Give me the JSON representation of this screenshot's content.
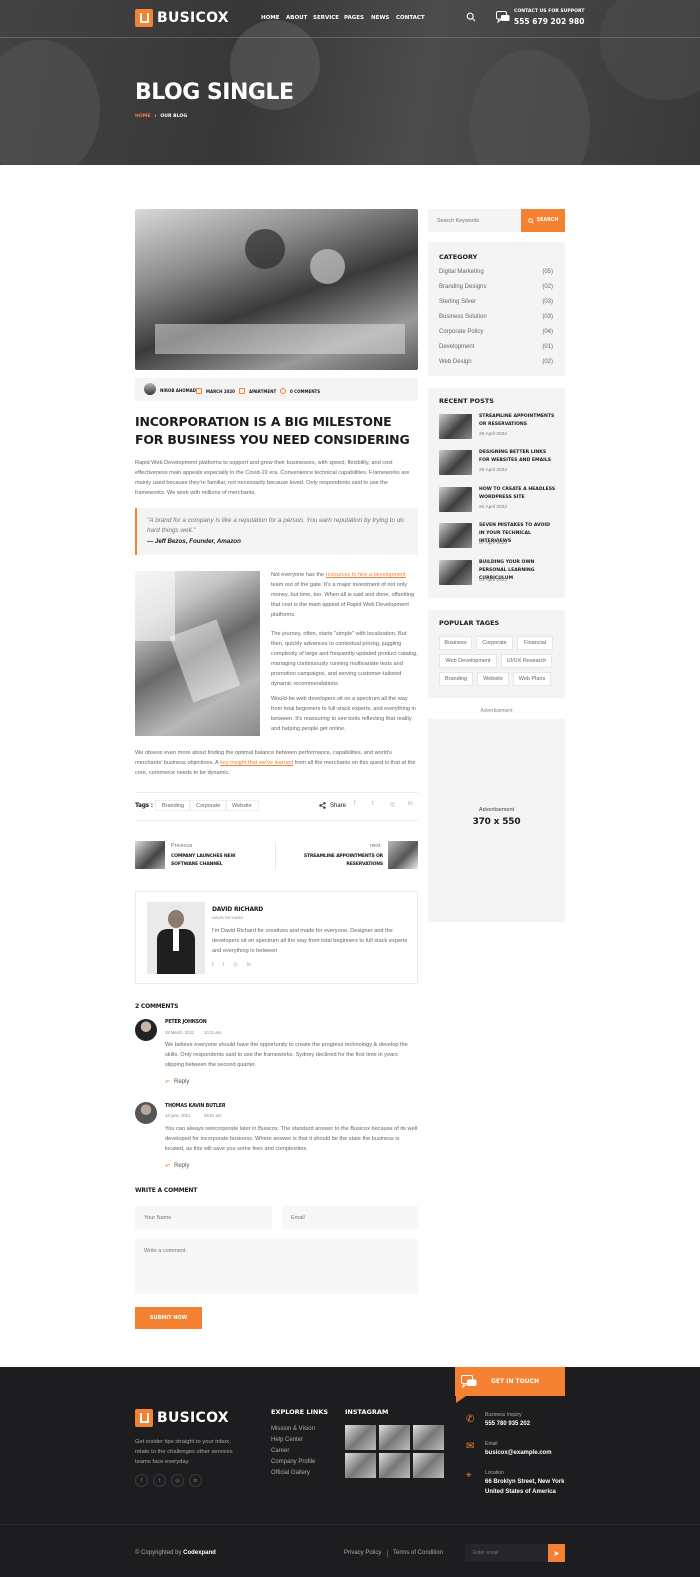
{
  "brand": {
    "name": "BUSICOX",
    "accent": "#f58133",
    "dark": "#1d1d1f"
  },
  "nav": {
    "items": [
      "HOME",
      "ABOUT",
      "SERVICE",
      "PAGES",
      "NEWS",
      "CONTACT"
    ],
    "support_label": "CONTACT US FOR SUPPORT",
    "support_phone": "555 679 202 980",
    "icons": {
      "search": "search-icon",
      "chat": "chat-icon"
    }
  },
  "hero": {
    "title": "BLOG SINGLE",
    "breadcrumb_home": "HOME",
    "breadcrumb_sep": "›",
    "breadcrumb_current": "OUR BLOG"
  },
  "sidebar": {
    "search_placeholder": "Search Keywords",
    "search_button": "SEARCH",
    "category_title": "CATEGORY",
    "categories": [
      {
        "name": "Digital Marketing",
        "count": "(05)"
      },
      {
        "name": "Branding Designs",
        "count": "(02)"
      },
      {
        "name": "Sterling Silver",
        "count": "(03)"
      },
      {
        "name": "Business Solution",
        "count": "(03)"
      },
      {
        "name": "Corporate Policy",
        "count": "(04)"
      },
      {
        "name": "Development",
        "count": "(01)"
      },
      {
        "name": "Web Design",
        "count": "(02)"
      }
    ],
    "recent_title": "RECENT POSTS",
    "recent": [
      {
        "title": "STREAMLINE APPOINTMENTS OR RESERVATIONS",
        "date": "28 April 2022"
      },
      {
        "title": "DESIGNING BETTER LINKS FOR WEBSITES AND EMAILS",
        "date": "25 April 2022"
      },
      {
        "title": "HOW TO CREATE A HEADLESS WORDPRESS SITE",
        "date": "20 April 2022"
      },
      {
        "title": "SEVEN MISTAKES TO AVOID IN YOUR TECHNICAL INTERVIEWS",
        "date": "07 April 2022"
      },
      {
        "title": "BUILDING YOUR OWN PERSONAL LEARNING CURRICULUM",
        "date": "03 April 2022"
      }
    ],
    "tags_title": "POPULAR TAGES",
    "tags": [
      "Business",
      "Corporate",
      "Financial",
      "Web Development",
      "UI/UX Research",
      "Branding",
      "Website",
      "Web Plans"
    ],
    "ad_caption": "Advertisement",
    "ad_label": "Advertisement",
    "ad_size": "370 x 550"
  },
  "article": {
    "meta": {
      "author": "NIROB AHOMAD",
      "date": "MARCH 2020",
      "category": "APARTMENT",
      "comments": "0 COMMENTS"
    },
    "title": "INCORPORATION IS A BIG MILESTONE FOR BUSINESS YOU NEED CONSIDERING",
    "intro": "Rapid Web Development platforms to support and grow their businesses, with speed, flexibility, and cost effectiveness main appeals especially in the Covid-19 era. Convenience technical capabilities. Frameworks are mainly used because they're familiar, not necessarily because loved. Only respondents said to use the frameworks. We work with millions of merchants.",
    "quote": "\"A brand for a company is like a reputation for a person. You earn reputation by trying to do hard things well.\"",
    "quote_author": "— Jeff Bezos, Founder, Amazon",
    "p1_before": "Not everyone has the ",
    "p1_link": "resources to hire a development",
    "p1_after": " team out of the gate. It's a major investment of not only money, but time, too. When all is said and done, offsetting that cost is the main appeal of Rapid Web Development platforms.",
    "p2": "The journey, often, starts \"simple\" with localization. But then, quickly advances to contextual pricing, juggling complexity of large and frequently updated product catalog, managing continuously running multivariate tests and promotion campaigns, and serving customer-tailored dynamic recommendations.",
    "p3": "Would-be web developers sit on a spectrum all the way from total beginners to full-stack experts, and everything in between. It's reassuring to see tools reflecting that reality and helping people get online.",
    "p4_before": "We obsess even more about finding the optimal balance between performance, capabilities, and world's merchants' business objectives. A ",
    "p4_link": "key insight that we've learned",
    "p4_after": " from all the merchants on this quest is that at the core, commerce needs to be dynamic.",
    "tags_label": "Tags :",
    "tags": [
      "Branding",
      "Corporate",
      "Website"
    ],
    "share_label": "Share",
    "prev_label": "Previous",
    "prev_title": "COMPANY LAUNCHES NEW SOFTWARE CHANNEL",
    "next_label": "next",
    "next_title": "STREAMLINE APPOINTMENTS OR RESERVATIONS",
    "author_name": "DAVID RICHARD",
    "author_role": "DAVID RICHARD",
    "author_bio": "I'm David Richard for creatives and made for everyone. Designer and the developers sit on spectrum all the way from total beginners to full stack experts and everything in between"
  },
  "comments": {
    "title": "2 COMMENTS",
    "items": [
      {
        "name": "PETER JOHNSON",
        "date": "28 March, 2021",
        "time": "10:11 am",
        "text": "We believe everyone should have the opportunity to create the progress technology & develop the skills. Only respondents said to use the frameworks. Sydney declined for the first time in years slipping between the second quarter.",
        "reply": "Reply"
      },
      {
        "name": "THOMAS KAVIN BUTLER",
        "date": "13 june, 2021",
        "time": "09:51 am",
        "text": "You can always reincorporate later in Busicox. The standard answer to the Busicox because of its well developed for incorporate business. Where answer is that it should be the state the business is located, as this will save you some fees and complexities.",
        "reply": "Reply"
      }
    ]
  },
  "form": {
    "title": "WRITE A COMMENT",
    "name_ph": "Your Name",
    "email_ph": "Email",
    "comment_ph": "Write a comment.",
    "submit": "SUBMIT NOW"
  },
  "footer": {
    "about": "Get insider tips straight to your inbox, relate to the challenges other services teams face everyday.",
    "links_title": "EXPLORE LINKS",
    "links": [
      "Mission & Vision",
      "Help Center",
      "Career",
      "Company Profile",
      "Official Gallery"
    ],
    "instagram_title": "INSTAGRAM",
    "contact_title": "GET IN TOUCH",
    "inquiry_label": "Business Inquiry",
    "inquiry_value": "555 780 935 202",
    "email_label": "Email",
    "email_value": "busicox@example.com",
    "location_label": "Location",
    "location_value": "66 Broklyn Street, New York United States of America",
    "copyright_prefix": "© Copyrighted by ",
    "copyright_name": "Codexpand",
    "privacy": "Privacy Policy",
    "terms": "Terms of Condition",
    "newsletter_ph": "Enter email"
  }
}
